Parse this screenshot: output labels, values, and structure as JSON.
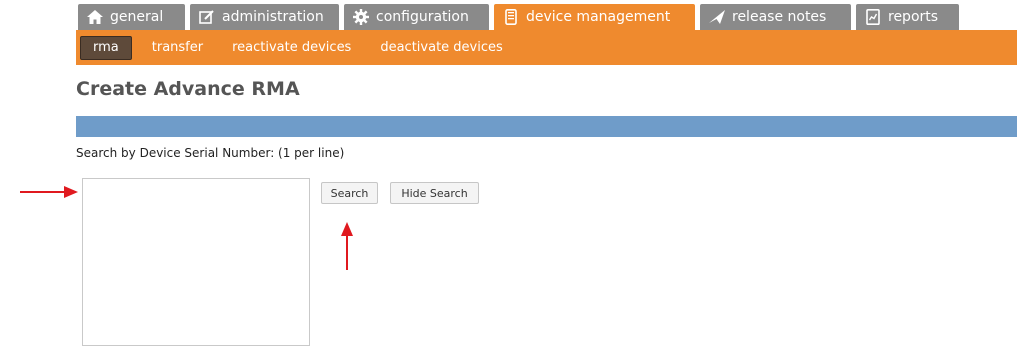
{
  "tabs": [
    {
      "label": "general",
      "icon": "home-icon"
    },
    {
      "label": "administration",
      "icon": "edit-icon"
    },
    {
      "label": "configuration",
      "icon": "gear-icon"
    },
    {
      "label": "device management",
      "icon": "device-icon",
      "active": true
    },
    {
      "label": "release notes",
      "icon": "send-icon"
    },
    {
      "label": "reports",
      "icon": "report-icon"
    }
  ],
  "subnav": [
    {
      "label": "rma",
      "active": true
    },
    {
      "label": "transfer"
    },
    {
      "label": "reactivate devices"
    },
    {
      "label": "deactivate devices"
    }
  ],
  "page": {
    "title": "Create Advance RMA"
  },
  "search": {
    "label": "Search by Device Serial Number: (1 per line)",
    "value": "",
    "search_button": "Search",
    "hide_button": "Hide Search"
  },
  "colors": {
    "accent": "#ef8a2e",
    "tab_inactive": "#8a8a8a",
    "bar_blue": "#6f9cc9",
    "annotation_arrow": "#e0191f"
  }
}
